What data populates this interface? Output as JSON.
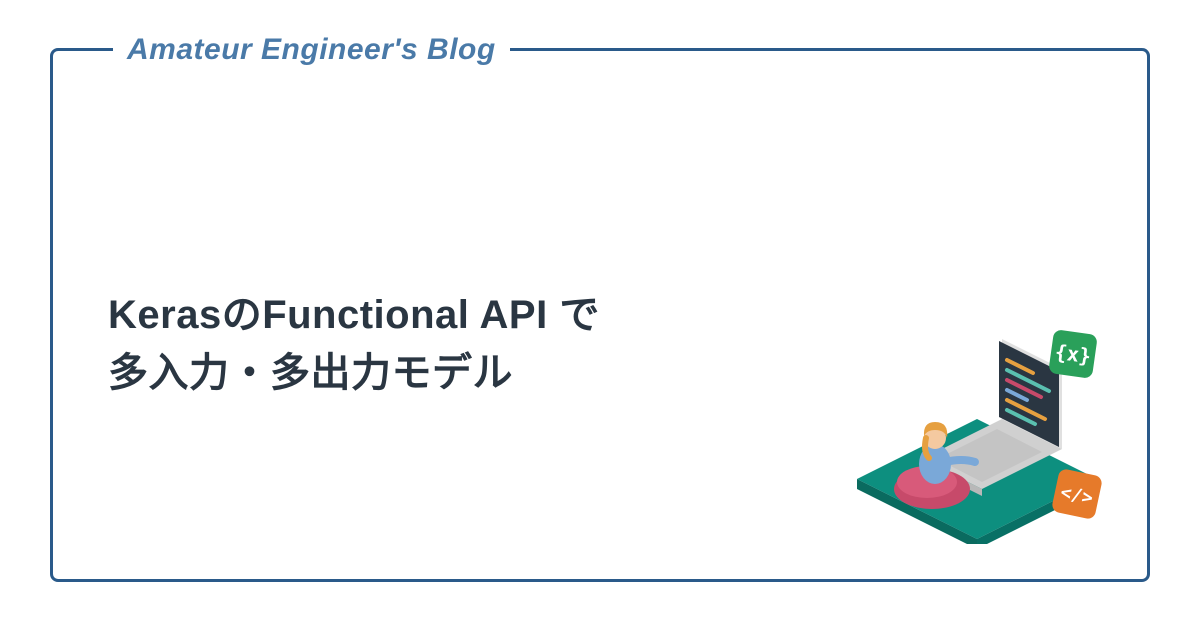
{
  "site": {
    "title": "Amateur Engineer's Blog"
  },
  "article": {
    "title_line1": "KerasのFunctional API で",
    "title_line2": "多入力・多出力モデル"
  },
  "illustration": {
    "description": "programmer-at-laptop-isometric",
    "badge_left_text": "{x}",
    "badge_right_text": "</>",
    "colors": {
      "platform": "#0d8f7f",
      "laptop_body": "#e8e8e8",
      "laptop_screen": "#2a3642",
      "badge_green": "#2aa05a",
      "badge_orange": "#e67a2a",
      "beanbag": "#c74a6a",
      "hair": "#e6a040",
      "shirt": "#7aa8d8"
    }
  }
}
